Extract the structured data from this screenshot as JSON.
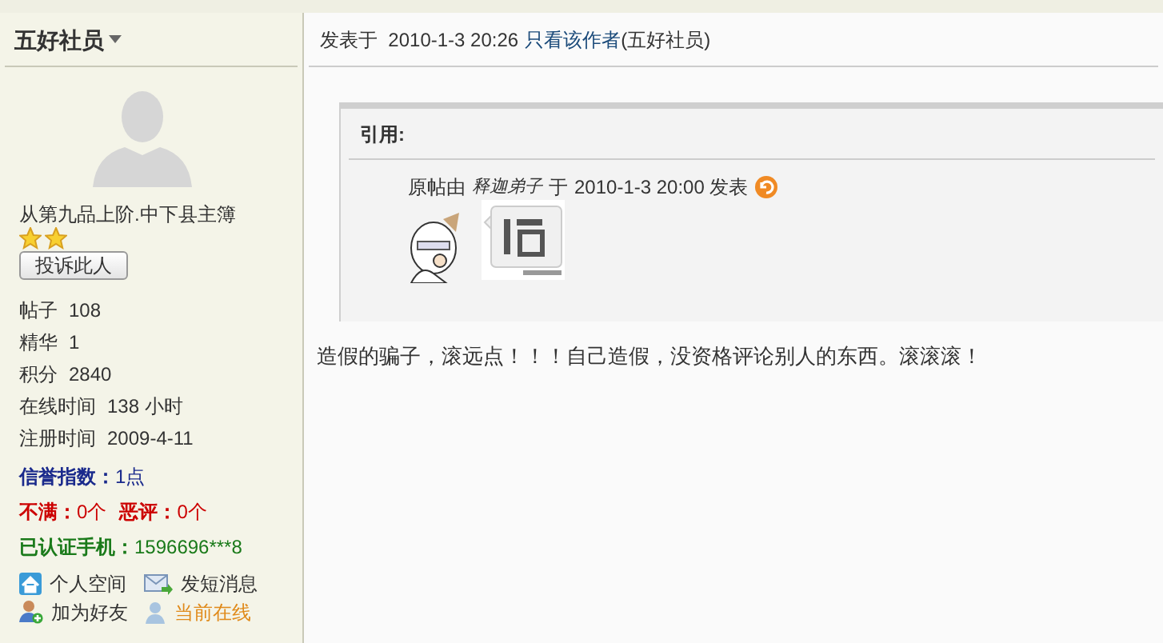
{
  "author": {
    "name": "五好社员",
    "rank": "从第九品上阶.中下县主簿",
    "rank_icons": [
      {
        "kind": "star"
      },
      {
        "kind": "star"
      }
    ],
    "report_button": "投诉此人",
    "stats": [
      {
        "label": "帖子",
        "value": "108"
      },
      {
        "label": "精华",
        "value": "1"
      },
      {
        "label": "积分",
        "value": "2840"
      },
      {
        "label": "在线时间",
        "value": "138 小时"
      },
      {
        "label": "注册时间",
        "value": "2009-4-11"
      }
    ],
    "credit": {
      "label": "信誉指数：",
      "value": "1点"
    },
    "complaints": [
      {
        "label": "不满：",
        "value": "0个"
      },
      {
        "label": "恶评：",
        "value": "0个"
      }
    ],
    "phone": {
      "label": "已认证手机：",
      "value": "1596696***8"
    },
    "actions": [
      {
        "kind": "home",
        "label": "个人空间",
        "highlight": false
      },
      {
        "kind": "mail",
        "label": "发短消息",
        "highlight": false
      },
      {
        "kind": "add-friend",
        "label": "加为好友",
        "highlight": false
      },
      {
        "kind": "online",
        "label": "当前在线",
        "highlight": true
      }
    ]
  },
  "post": {
    "posted_prefix": "发表于",
    "posted_time": "2010-1-3 20:26",
    "author_only_link": "只看该作者",
    "author_paren": "(五好社员)",
    "quote": {
      "title": "引用:",
      "original_prefix": "原帖由",
      "original_author": "释迦弟子",
      "original_mid": "于",
      "original_time": "2010-1-3 20:00 发表"
    },
    "body": "造假的骗子，滚远点！！！自己造假，没资格评论别人的东西。滚滚滚！"
  }
}
